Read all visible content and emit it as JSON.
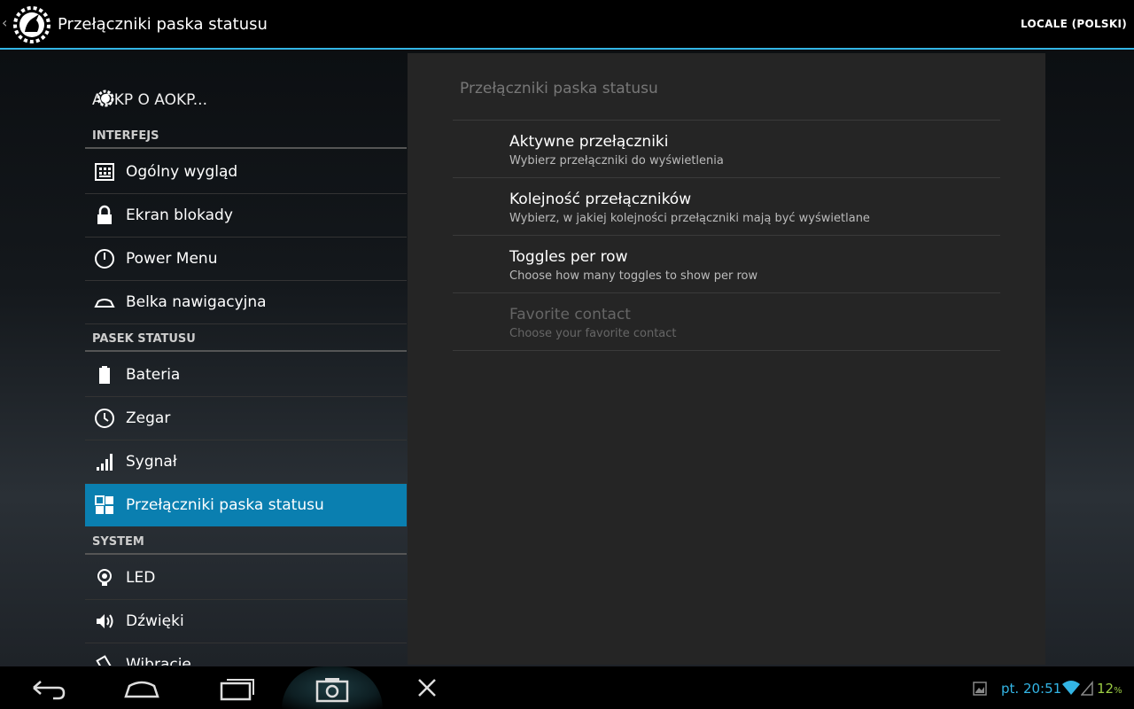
{
  "actionbar": {
    "title": "Przełączniki paska statusu",
    "locale_label": "LOCALE (POLSKI)"
  },
  "left": {
    "about_label": "AOKP  O AOKP...",
    "sections": {
      "interface": "INTERFEJS",
      "statusbar": "PASEK STATUSU",
      "system": "SYSTEM"
    },
    "items": [
      {
        "label": "Ogólny wygląd",
        "icon": "grid-icon"
      },
      {
        "label": "Ekran blokady",
        "icon": "lock-icon"
      },
      {
        "label": "Power Menu",
        "icon": "power-icon"
      },
      {
        "label": "Belka nawigacyjna",
        "icon": "navbar-icon"
      },
      {
        "label": "Bateria",
        "icon": "battery-icon"
      },
      {
        "label": "Zegar",
        "icon": "clock-icon"
      },
      {
        "label": "Sygnał",
        "icon": "signal-icon"
      },
      {
        "label": "Przełączniki paska statusu",
        "icon": "toggles-icon",
        "active": true
      },
      {
        "label": "LED",
        "icon": "led-icon"
      },
      {
        "label": "Dźwięki",
        "icon": "speaker-icon"
      },
      {
        "label": "Wibracje",
        "icon": "vibrate-icon"
      }
    ]
  },
  "right": {
    "title": "Przełączniki paska statusu",
    "prefs": [
      {
        "title": "Aktywne przełączniki",
        "summary": "Wybierz przełączniki do wyświetlenia",
        "enabled": true
      },
      {
        "title": "Kolejność przełączników",
        "summary": "Wybierz, w jakiej kolejności przełączniki mają być wyświetlane",
        "enabled": true
      },
      {
        "title": "Toggles per row",
        "summary": "Choose how many toggles to show per row",
        "enabled": true
      },
      {
        "title": "Favorite contact",
        "summary": "Choose your favorite contact",
        "enabled": false
      }
    ]
  },
  "systembar": {
    "clock": "pt. 20:51",
    "battery": "12",
    "battery_unit": "%"
  },
  "colors": {
    "accent": "#33b5e5",
    "active_item": "#0a7fb0",
    "battery_text": "#9ccc44"
  }
}
